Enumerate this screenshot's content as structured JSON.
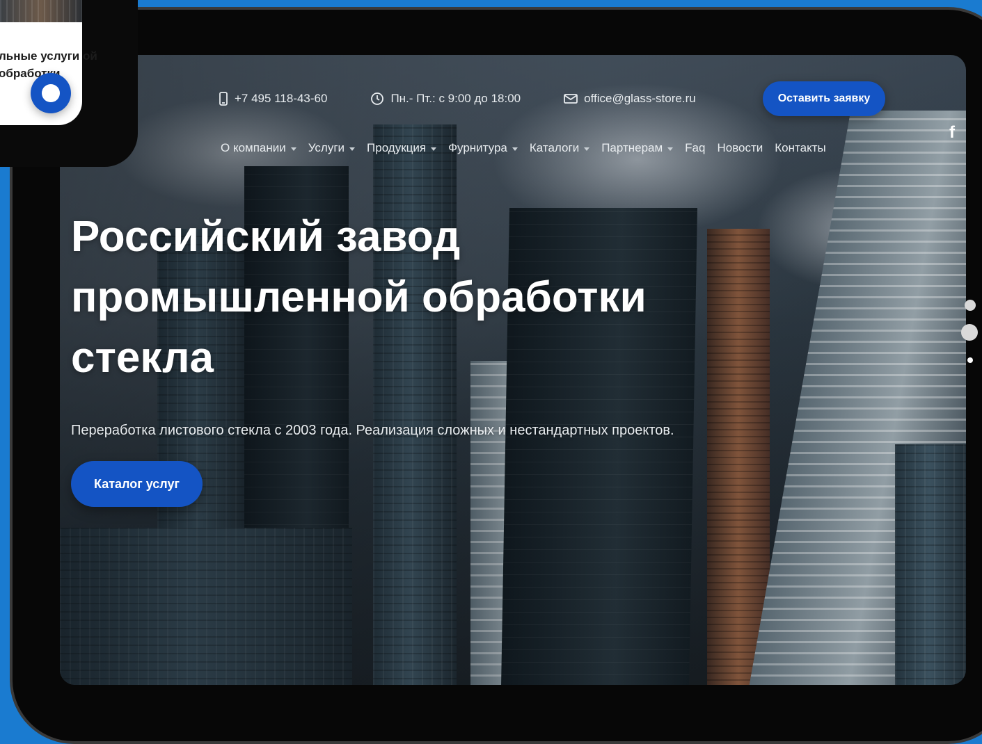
{
  "phone_card": {
    "text": "льные услуги ой обработки"
  },
  "header": {
    "phone": "+7 495 118-43-60",
    "hours": "Пн.- Пт.: с 9:00 до 18:00",
    "email": "office@glass-store.ru",
    "cta": "Оставить заявку",
    "social_icon": "facebook-icon"
  },
  "nav": {
    "items": [
      {
        "label": "О компании",
        "dropdown": true
      },
      {
        "label": "Услуги",
        "dropdown": true
      },
      {
        "label": "Продукция",
        "dropdown": true
      },
      {
        "label": "Фурнитура",
        "dropdown": true
      },
      {
        "label": "Каталоги",
        "dropdown": true
      },
      {
        "label": "Партнерам",
        "dropdown": true
      },
      {
        "label": "Faq",
        "dropdown": false
      },
      {
        "label": "Новости",
        "dropdown": false
      },
      {
        "label": "Контакты",
        "dropdown": false
      }
    ]
  },
  "hero": {
    "title_line1": "Российский завод",
    "title_line2": "промышленной обработки",
    "title_line3": "стекла",
    "subtitle": "Переработка листового стекла с 2003 года. Реализация сложных и нестандартных проектов.",
    "cta": "Каталог услуг"
  },
  "colors": {
    "accent": "#1454c4",
    "background": "#1a7bd0"
  }
}
